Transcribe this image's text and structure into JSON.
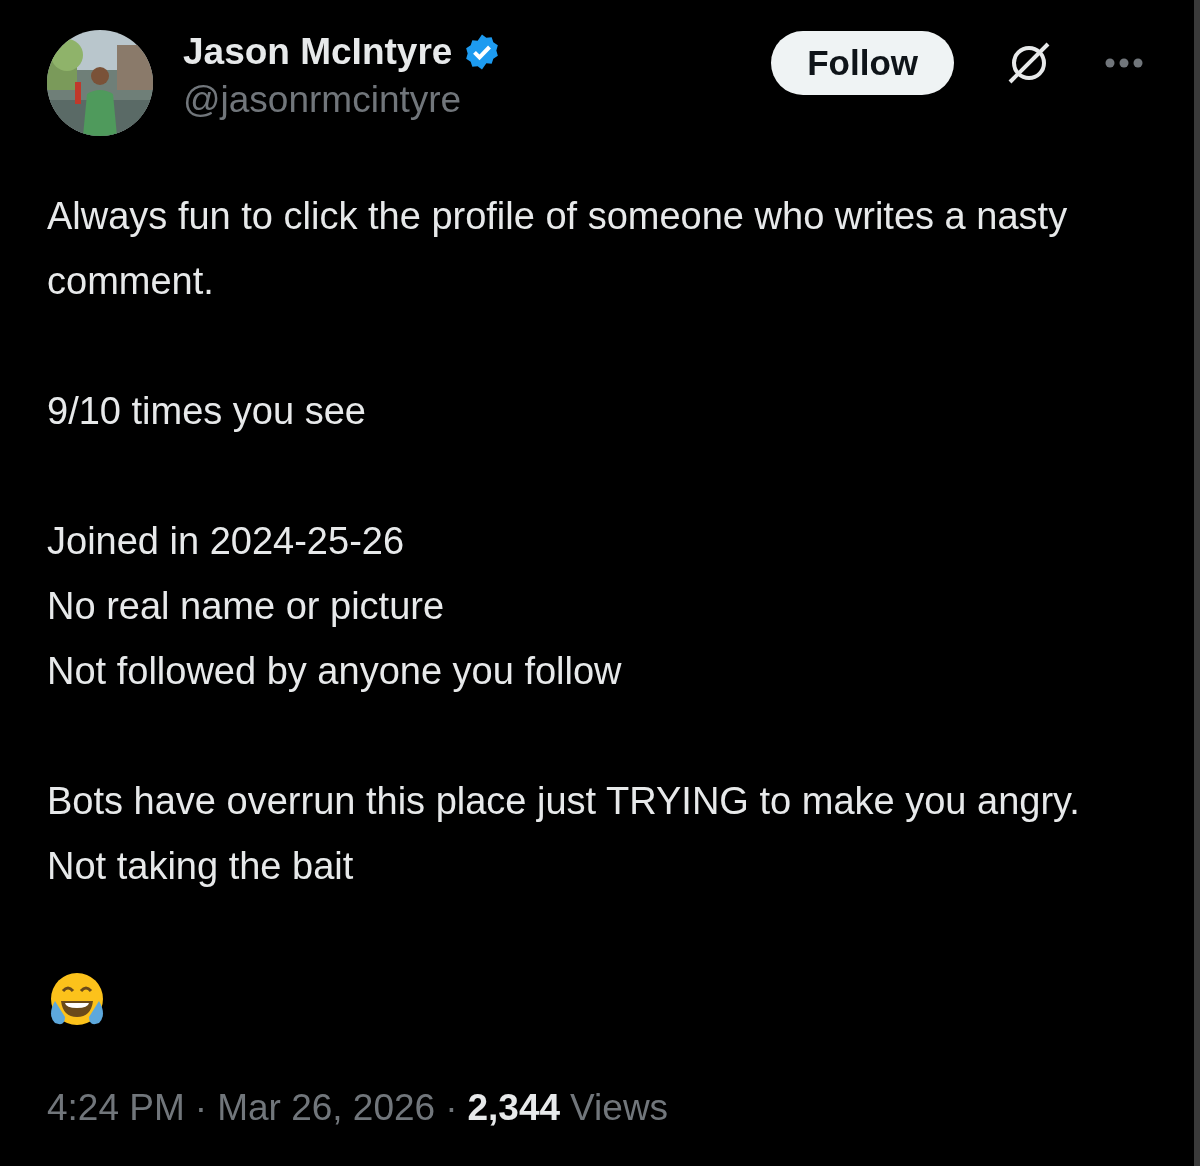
{
  "author": {
    "name": "Jason McIntyre",
    "verified": true,
    "handle": "@jasonrmcintyre"
  },
  "follow_button": {
    "label": "Follow"
  },
  "body": {
    "paragraphs": [
      "Always fun to click the profile of someone who writes a nasty comment.",
      "9/10 times you see",
      "Joined in 2024-25-26\nNo real name or picture\nNot followed by anyone you follow",
      "Bots have overrun this place just TRYING to make you angry. Not taking the bait"
    ]
  },
  "meta": {
    "time": "4:24 PM",
    "separator_1": "·",
    "date": "Mar 26, 2026",
    "separator_2": "·",
    "views_count": "2,344",
    "views_label": "Views"
  }
}
